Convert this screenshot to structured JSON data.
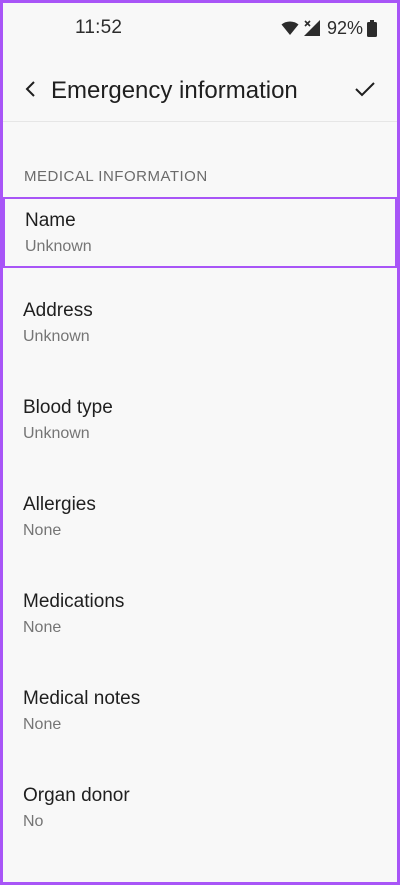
{
  "status_bar": {
    "time": "11:52",
    "battery": "92%",
    "icons": [
      "wifi-icon",
      "no-signal-icon",
      "battery-icon"
    ]
  },
  "app_bar": {
    "title": "Emergency information",
    "back_icon": "back-arrow-icon",
    "confirm_icon": "check-icon"
  },
  "section": {
    "header": "MEDICAL INFORMATION",
    "items": [
      {
        "title": "Name",
        "value": "Unknown"
      },
      {
        "title": "Address",
        "value": "Unknown"
      },
      {
        "title": "Blood type",
        "value": "Unknown"
      },
      {
        "title": "Allergies",
        "value": "None"
      },
      {
        "title": "Medications",
        "value": "None"
      },
      {
        "title": "Medical notes",
        "value": "None"
      },
      {
        "title": "Organ donor",
        "value": "No"
      }
    ]
  },
  "colors": {
    "highlight": "#a855f7",
    "background": "#f8f8f8",
    "text_primary": "#1f1f1f",
    "text_secondary": "#757575"
  }
}
